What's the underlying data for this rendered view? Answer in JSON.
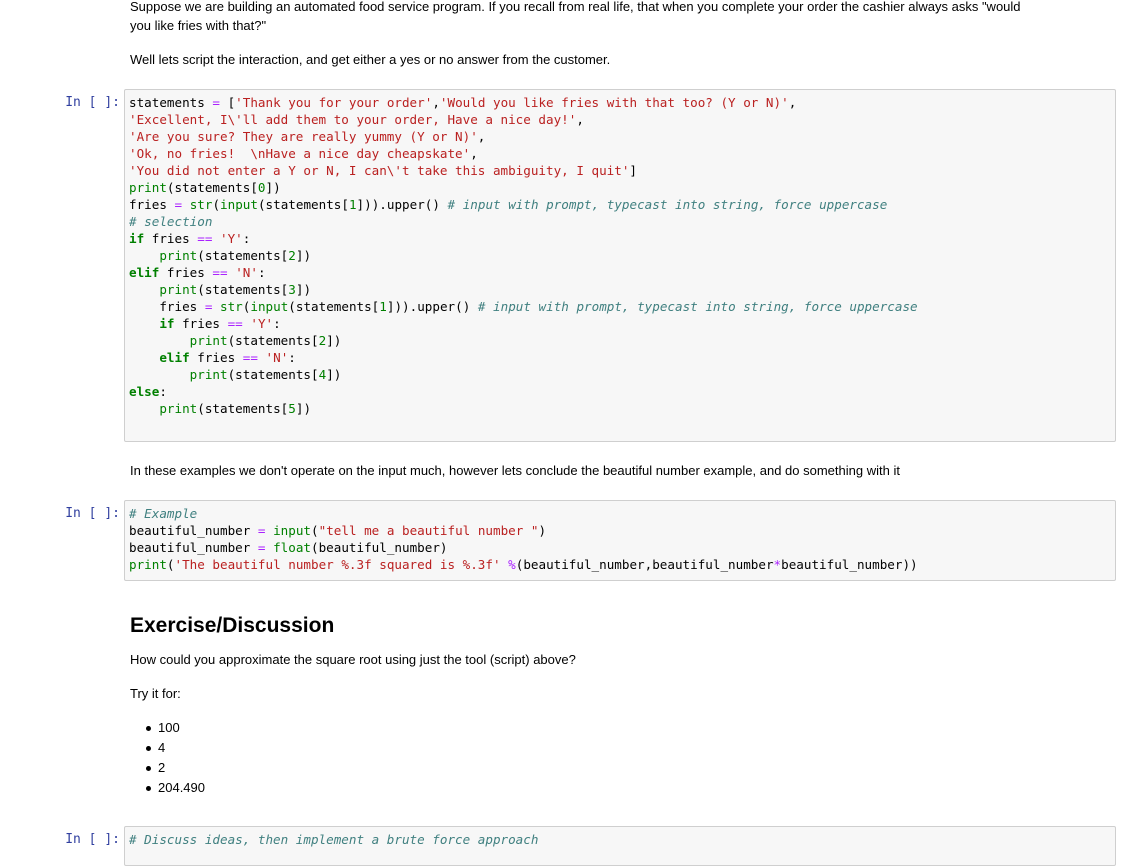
{
  "intro": {
    "line1": "Suppose we are building an automated food service program. If you recall from real life, that when you complete your order the cashier always asks \"would",
    "line2": "you like fries with that?\"",
    "line3": "Well lets script the interaction, and get either a yes or no answer from the customer."
  },
  "cell1": {
    "prompt": "In [ ]:",
    "lines": [
      [
        [
          "",
          "statements "
        ],
        [
          "o",
          "="
        ],
        [
          "",
          " ["
        ],
        [
          "s",
          "'Thank you for your order'"
        ],
        [
          "",
          ","
        ],
        [
          "s",
          "'Would you like fries with that too? (Y or N)'"
        ],
        [
          "",
          ","
        ]
      ],
      [
        [
          "s",
          "'Excellent, I\\'ll add them to your order, Have a nice day!'"
        ],
        [
          "",
          ","
        ]
      ],
      [
        [
          "s",
          "'Are you sure? They are really yummy (Y or N)'"
        ],
        [
          "",
          ","
        ]
      ],
      [
        [
          "s",
          "'Ok, no fries!  \\nHave a nice day cheapskate'"
        ],
        [
          "",
          ","
        ]
      ],
      [
        [
          "s",
          "'You did not enter a Y or N, I can\\'t take this ambiguity, I quit'"
        ],
        [
          "",
          "]"
        ]
      ],
      [
        [
          "b",
          "print"
        ],
        [
          "",
          "(statements["
        ],
        [
          "n",
          "0"
        ],
        [
          "",
          "])"
        ]
      ],
      [
        [
          "",
          "fries "
        ],
        [
          "o",
          "="
        ],
        [
          "",
          " "
        ],
        [
          "b",
          "str"
        ],
        [
          "",
          "("
        ],
        [
          "b",
          "input"
        ],
        [
          "",
          "(statements["
        ],
        [
          "n",
          "1"
        ],
        [
          "",
          "]))"
        ],
        [
          "",
          ".upper() "
        ],
        [
          "c",
          "# input with prompt, typecast into string, force uppercase"
        ]
      ],
      [
        [
          "c",
          "# selection"
        ]
      ],
      [
        [
          "k",
          "if"
        ],
        [
          "",
          " fries "
        ],
        [
          "o",
          "=="
        ],
        [
          "",
          " "
        ],
        [
          "s",
          "'Y'"
        ],
        [
          "",
          ":"
        ]
      ],
      [
        [
          "",
          "    "
        ],
        [
          "b",
          "print"
        ],
        [
          "",
          "(statements["
        ],
        [
          "n",
          "2"
        ],
        [
          "",
          "])"
        ]
      ],
      [
        [
          "k",
          "elif"
        ],
        [
          "",
          " fries "
        ],
        [
          "o",
          "=="
        ],
        [
          "",
          " "
        ],
        [
          "s",
          "'N'"
        ],
        [
          "",
          ":"
        ]
      ],
      [
        [
          "",
          "    "
        ],
        [
          "b",
          "print"
        ],
        [
          "",
          "(statements["
        ],
        [
          "n",
          "3"
        ],
        [
          "",
          "])"
        ]
      ],
      [
        [
          "",
          "    fries "
        ],
        [
          "o",
          "="
        ],
        [
          "",
          " "
        ],
        [
          "b",
          "str"
        ],
        [
          "",
          "("
        ],
        [
          "b",
          "input"
        ],
        [
          "",
          "(statements["
        ],
        [
          "n",
          "1"
        ],
        [
          "",
          "]))"
        ],
        [
          "",
          ".upper() "
        ],
        [
          "c",
          "# input with prompt, typecast into string, force uppercase"
        ]
      ],
      [
        [
          "",
          "    "
        ],
        [
          "k",
          "if"
        ],
        [
          "",
          " fries "
        ],
        [
          "o",
          "=="
        ],
        [
          "",
          " "
        ],
        [
          "s",
          "'Y'"
        ],
        [
          "",
          ":"
        ]
      ],
      [
        [
          "",
          "        "
        ],
        [
          "b",
          "print"
        ],
        [
          "",
          "(statements["
        ],
        [
          "n",
          "2"
        ],
        [
          "",
          "])"
        ]
      ],
      [
        [
          "",
          "    "
        ],
        [
          "k",
          "elif"
        ],
        [
          "",
          " fries "
        ],
        [
          "o",
          "=="
        ],
        [
          "",
          " "
        ],
        [
          "s",
          "'N'"
        ],
        [
          "",
          ":"
        ]
      ],
      [
        [
          "",
          "        "
        ],
        [
          "b",
          "print"
        ],
        [
          "",
          "(statements["
        ],
        [
          "n",
          "4"
        ],
        [
          "",
          "])"
        ]
      ],
      [
        [
          "k",
          "else"
        ],
        [
          "",
          ":"
        ]
      ],
      [
        [
          "",
          "    "
        ],
        [
          "b",
          "print"
        ],
        [
          "",
          "(statements["
        ],
        [
          "n",
          "5"
        ],
        [
          "",
          "])"
        ]
      ]
    ]
  },
  "middle_text": "In these examples we don't operate on the input much, however lets conclude the beautiful number example, and do something with it",
  "cell2": {
    "prompt": "In [ ]:",
    "lines": [
      [
        [
          "c",
          "# Example"
        ]
      ],
      [
        [
          "",
          "beautiful_number "
        ],
        [
          "o",
          "="
        ],
        [
          "",
          " "
        ],
        [
          "b",
          "input"
        ],
        [
          "",
          "("
        ],
        [
          "s",
          "\"tell me a beautiful number \""
        ],
        [
          "",
          ")"
        ]
      ],
      [
        [
          "",
          "beautiful_number "
        ],
        [
          "o",
          "="
        ],
        [
          "",
          " "
        ],
        [
          "b",
          "float"
        ],
        [
          "",
          "(beautiful_number)"
        ]
      ],
      [
        [
          "b",
          "print"
        ],
        [
          "",
          "("
        ],
        [
          "s",
          "'The beautiful number %.3f squared is %.3f'"
        ],
        [
          "",
          " "
        ],
        [
          "o",
          "%"
        ],
        [
          "",
          "(beautiful_number,beautiful_number"
        ],
        [
          "o",
          "*"
        ],
        [
          "",
          "beautiful_number))"
        ]
      ]
    ]
  },
  "exercise": {
    "heading": "Exercise/Discussion",
    "question": "How could you approximate the square root using just the tool (script) above?",
    "try_label": "Try it for:",
    "items": [
      "100",
      "4",
      "2",
      "204.490"
    ]
  },
  "cell3": {
    "prompt": "In [ ]:",
    "lines": [
      [
        [
          "c",
          "# Discuss ideas, then implement a brute force approach"
        ]
      ]
    ]
  },
  "colors": {
    "prompt": "#303f9f",
    "string": "#ba2121",
    "keyword": "#008000",
    "comment": "#408080",
    "operator": "#aa22ff"
  }
}
